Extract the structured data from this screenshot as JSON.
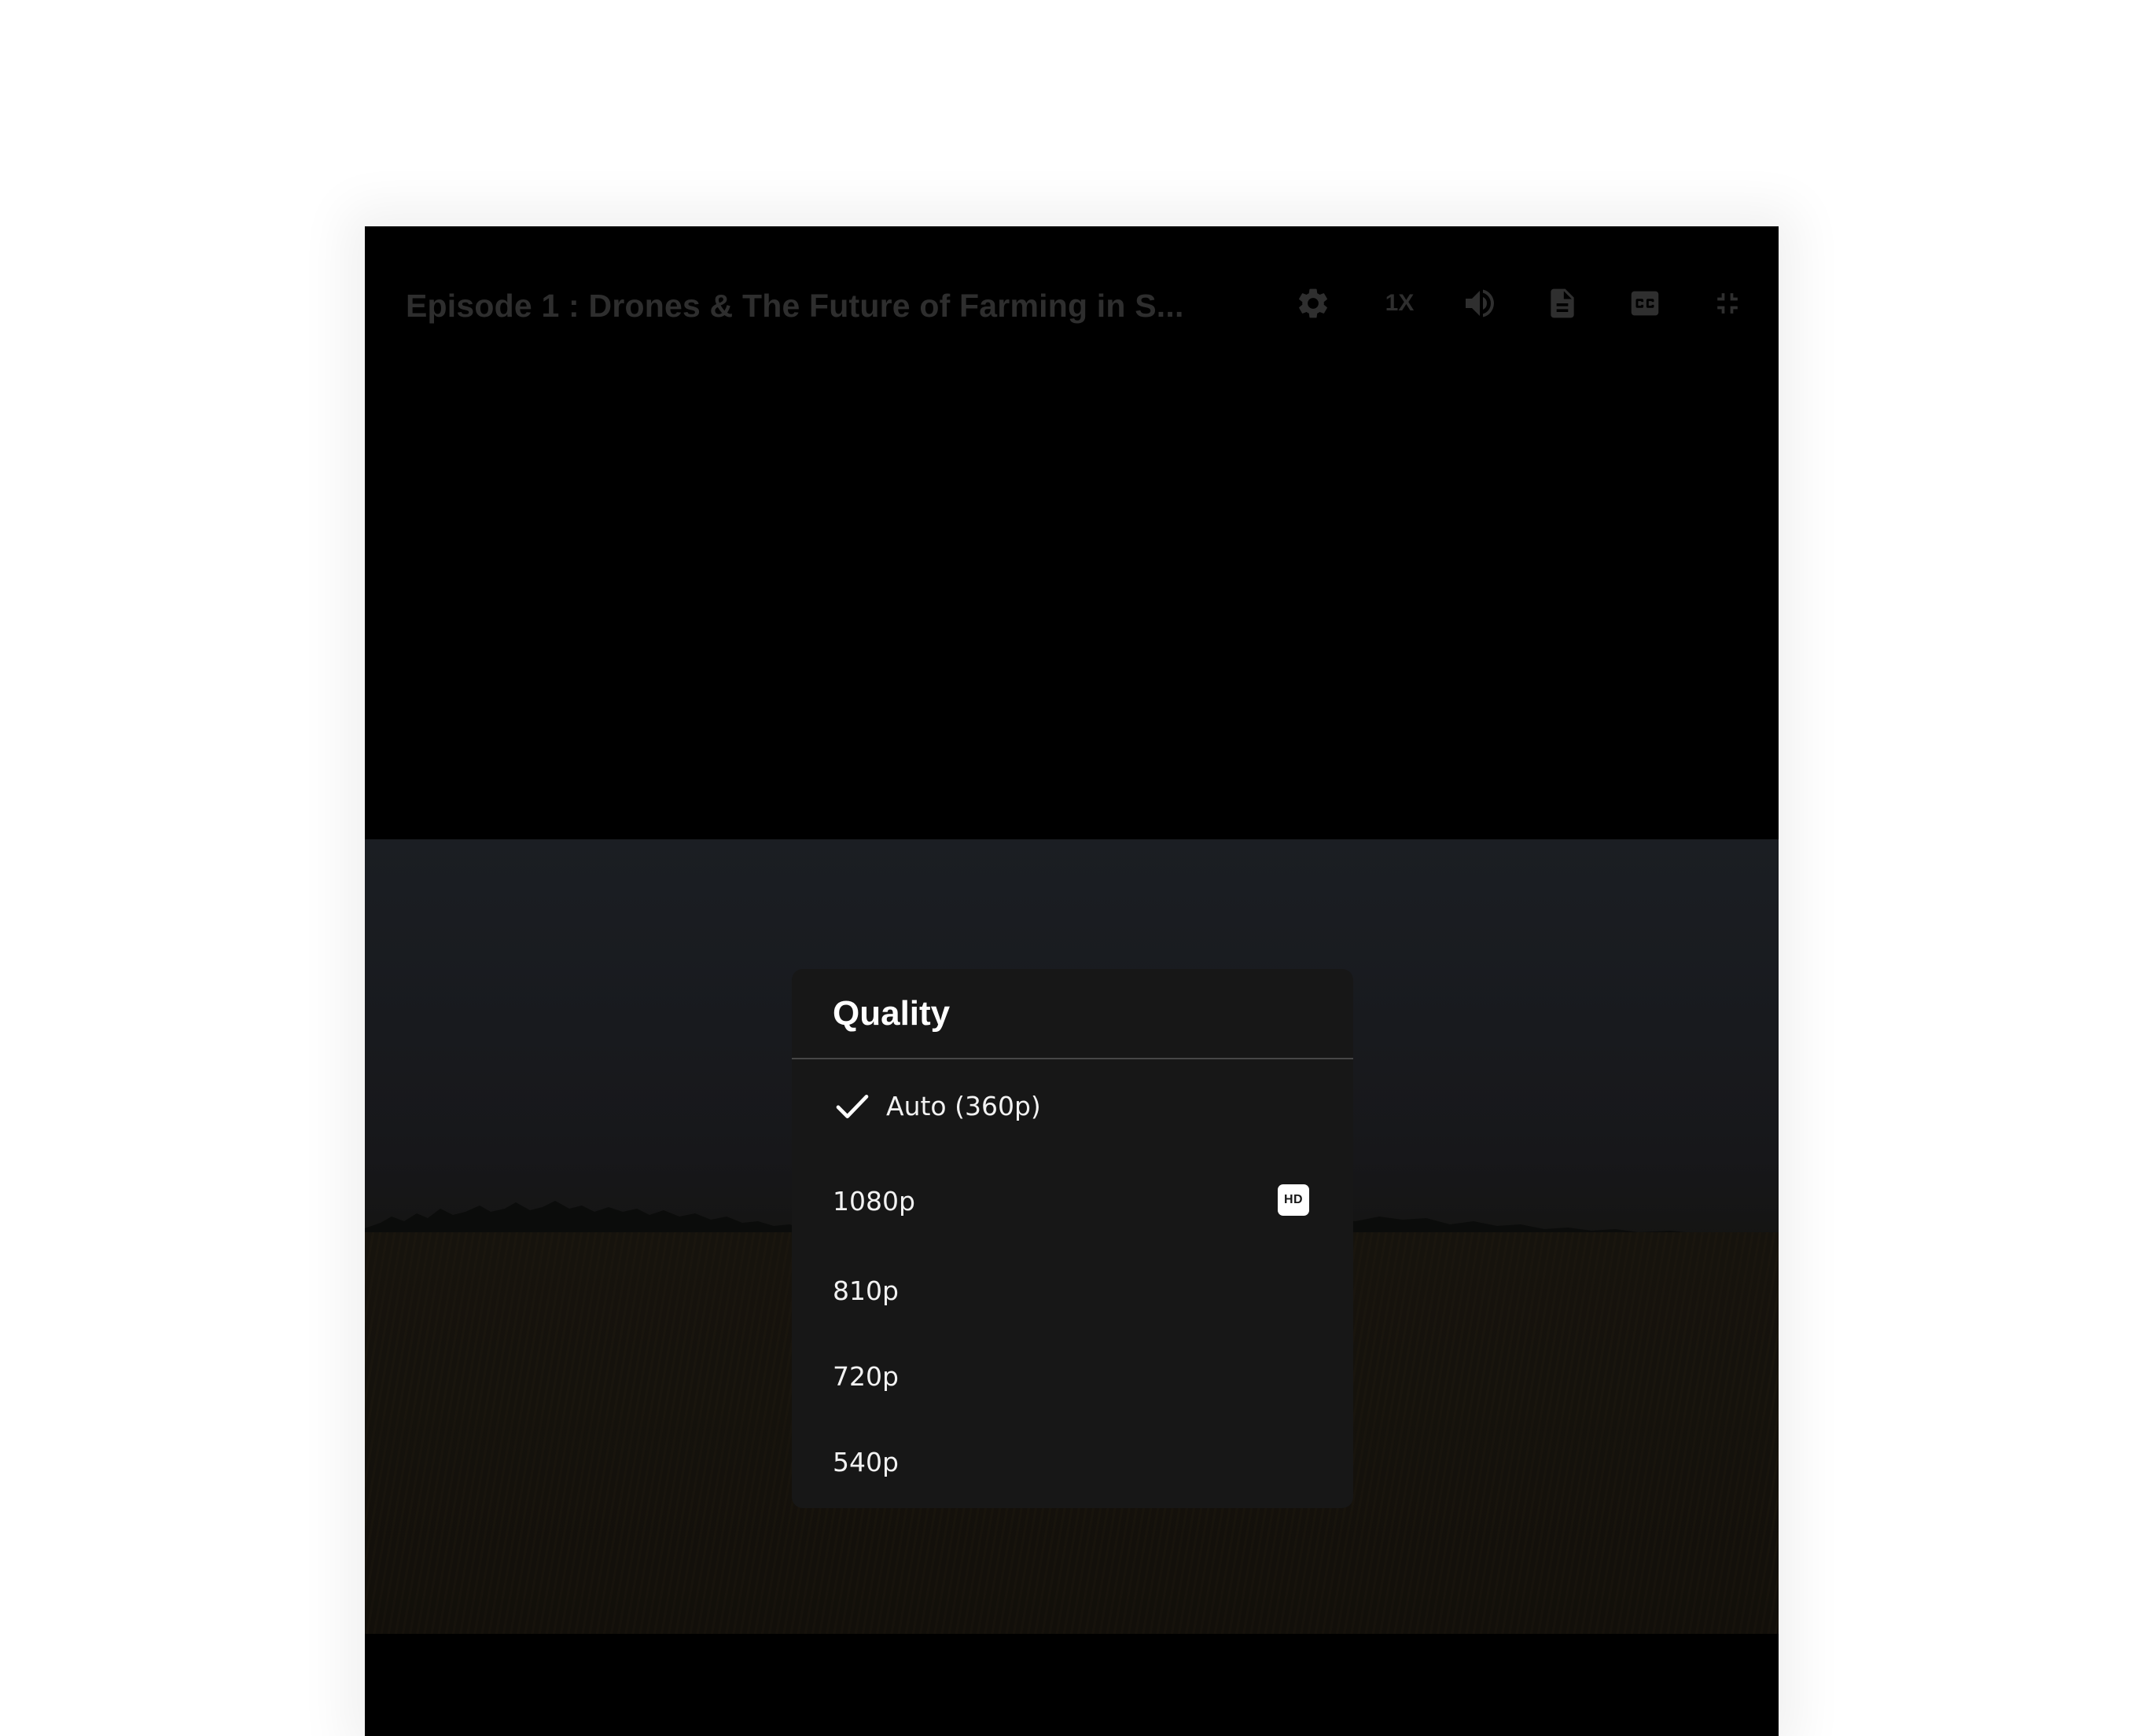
{
  "player": {
    "title": "Episode 1 : Drones & The Future of Farming in S...",
    "controls": {
      "settings_icon": "gear-icon",
      "speed_label": "1X",
      "volume_icon": "volume-icon",
      "transcript_icon": "document-icon",
      "captions_icon": "cc-icon",
      "exit_fullscreen_icon": "exit-fullscreen-icon"
    }
  },
  "quality_menu": {
    "title": "Quality",
    "options": [
      {
        "label": "Auto (360p)",
        "selected": true,
        "badge": ""
      },
      {
        "label": "1080p",
        "selected": false,
        "badge": "HD"
      },
      {
        "label": "810p",
        "selected": false,
        "badge": ""
      },
      {
        "label": "720p",
        "selected": false,
        "badge": ""
      },
      {
        "label": "540p",
        "selected": false,
        "badge": ""
      }
    ]
  },
  "colors": {
    "menu_background": "#171717",
    "menu_divider": "#474747",
    "menu_text": "#ffffff",
    "dimmed_controls": "#2f2f2f"
  }
}
